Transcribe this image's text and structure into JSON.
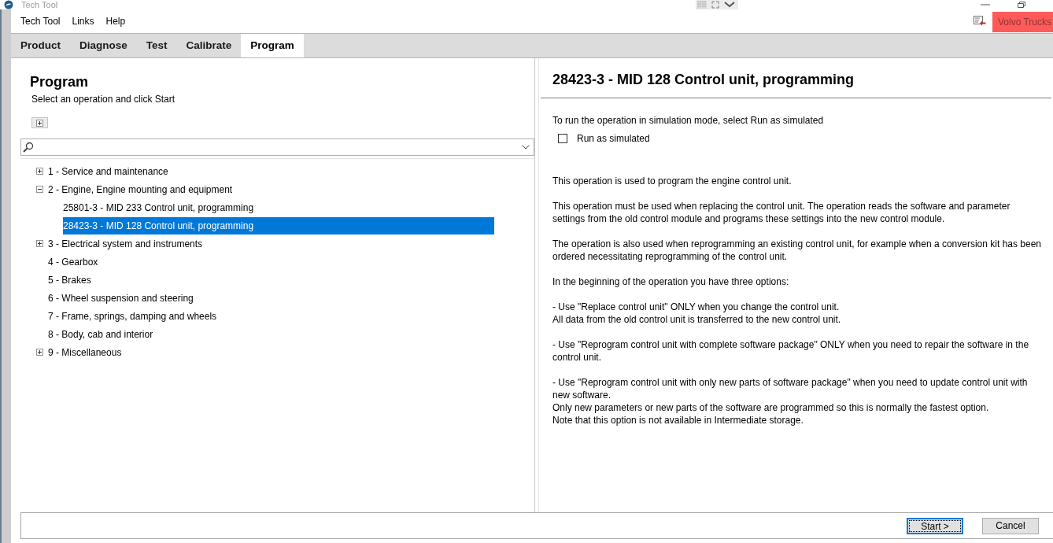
{
  "window": {
    "title": "Tech Tool"
  },
  "menu_bar": {
    "items": [
      "Tech Tool",
      "Links",
      "Help"
    ],
    "brand_button": "Volvo Trucks"
  },
  "tabs": [
    {
      "label": "Product",
      "selected": false
    },
    {
      "label": "Diagnose",
      "selected": false
    },
    {
      "label": "Test",
      "selected": false
    },
    {
      "label": "Calibrate",
      "selected": false
    },
    {
      "label": "Program",
      "selected": true
    }
  ],
  "left_panel": {
    "title": "Program",
    "subtitle": "Select an operation and click Start",
    "tree": [
      {
        "label": "1 - Service and maintenance",
        "expanded": false,
        "selected": false
      },
      {
        "label": "2 - Engine, Engine mounting and equipment",
        "expanded": true,
        "selected": false,
        "children": [
          {
            "label": "25801-3 - MID 233 Control unit, programming",
            "selected": false
          },
          {
            "label": "28423-3 - MID 128 Control unit, programming",
            "selected": true
          }
        ]
      },
      {
        "label": "3 - Electrical system and instruments",
        "expanded": false,
        "selected": false
      },
      {
        "label": "4 - Gearbox",
        "selected": false
      },
      {
        "label": "5 - Brakes",
        "selected": false
      },
      {
        "label": "6 - Wheel suspension and steering",
        "selected": false
      },
      {
        "label": "7 - Frame, springs, damping and wheels",
        "selected": false
      },
      {
        "label": "8 - Body, cab and interior",
        "selected": false
      },
      {
        "label": "9 - Miscellaneous",
        "expanded": false,
        "selected": false
      }
    ]
  },
  "right_panel": {
    "title": "28423-3 - MID 128 Control unit, programming",
    "simulation_hint": "To run the operation in simulation mode, select Run as simulated",
    "run_as_simulated": {
      "label": "Run as simulated",
      "checked": false
    },
    "description": [
      [
        "This operation is used to program the engine control unit."
      ],
      [
        "This operation must be used when replacing the control unit. The operation reads the software and parameter settings from the old control module and programs these settings into the new control module."
      ],
      [
        "The operation is also used when reprogramming an existing control unit, for example when a conversion kit has been ordered necessitating reprogramming of the control unit."
      ],
      [
        "In the beginning of the operation you have three options:"
      ],
      [
        "- Use \"Replace control unit\" ONLY when you change the control unit.",
        "All data from the old control unit is transferred to the new control unit."
      ],
      [
        "- Use \"Reprogram control unit with complete software package\" ONLY when you need to repair the software in the control unit."
      ],
      [
        "- Use \"Reprogram control unit with only new parts of software package\" when you need to update control unit with new software.",
        "Only new parameters or new parts of the software are programmed so this is normally the fastest option.",
        "Note that this option is not available in Intermediate storage."
      ]
    ]
  },
  "buttons": [
    {
      "label": "Start >",
      "focused": true
    },
    {
      "label": "Cancel",
      "focused": false
    }
  ]
}
